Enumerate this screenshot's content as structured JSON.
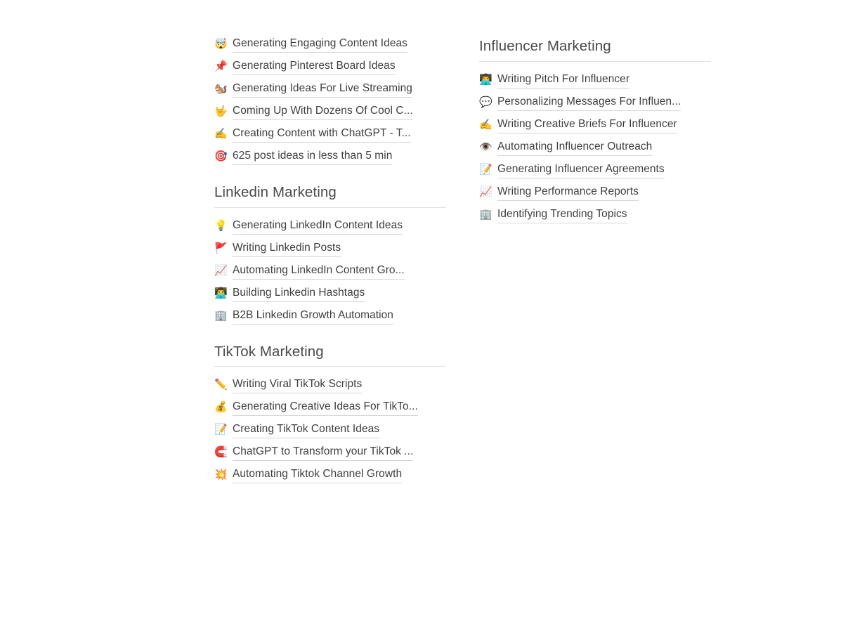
{
  "page": {
    "background_color": "#ffffff",
    "text_color": "#3f3f3f",
    "header_color": "#4a4a4a",
    "rule_color": "#e0e0e0",
    "underline_color": "#d6d6d6"
  },
  "columns": [
    {
      "name": "left-column",
      "sections": [
        {
          "id": "content-ideas",
          "heading": null,
          "items": [
            {
              "icon": "exploding-head-emoji",
              "glyph": "🤯",
              "label": "Generating Engaging Content Ideas",
              "truncated": false
            },
            {
              "icon": "pushpin-emoji",
              "glyph": "📌",
              "label": "Generating Pinterest Board Ideas",
              "truncated": false
            },
            {
              "icon": "chipmunk-emoji",
              "glyph": "🐿️",
              "label": "Generating Ideas For Live Streaming",
              "truncated": false
            },
            {
              "icon": "love-you-gesture-emoji",
              "glyph": "🤟",
              "label": "Coming Up With Dozens Of Cool C...",
              "truncated": true
            },
            {
              "icon": "writing-hand-emoji",
              "glyph": "✍️",
              "label": "Creating Content with ChatGPT - T...",
              "truncated": true
            },
            {
              "icon": "direct-hit-emoji",
              "glyph": "🎯",
              "label": "625 post ideas in less than 5 min",
              "truncated": false
            }
          ]
        },
        {
          "id": "linkedin-marketing",
          "heading": "Linkedin Marketing",
          "items": [
            {
              "icon": "light-bulb-emoji",
              "glyph": "💡",
              "label": "Generating LinkedIn Content Ideas",
              "truncated": false
            },
            {
              "icon": "triangular-flag-emoji",
              "glyph": "🚩",
              "label": "Writing Linkedin Posts",
              "truncated": false
            },
            {
              "icon": "chart-increasing-emoji",
              "glyph": "📈",
              "label": "Automating LinkedIn Content Gro...",
              "truncated": true
            },
            {
              "icon": "technologist-emoji",
              "glyph": "👨‍💻",
              "label": "Building Linkedin Hashtags",
              "truncated": false
            },
            {
              "icon": "office-building-emoji",
              "glyph": "🏢",
              "label": "B2B Linkedin Growth Automation",
              "truncated": false
            }
          ]
        },
        {
          "id": "tiktok-marketing",
          "heading": "TikTok Marketing",
          "items": [
            {
              "icon": "pencil-emoji",
              "glyph": "✏️",
              "label": "Writing Viral TikTok Scripts",
              "truncated": false
            },
            {
              "icon": "money-bag-emoji",
              "glyph": "💰",
              "label": "Generating Creative Ideas For TikTo...",
              "truncated": true
            },
            {
              "icon": "memo-emoji",
              "glyph": "📝",
              "label": "Creating TikTok Content Ideas",
              "truncated": false
            },
            {
              "icon": "magnet-emoji",
              "glyph": "🧲",
              "label": "ChatGPT to Transform your TikTok ...",
              "truncated": true
            },
            {
              "icon": "collision-emoji",
              "glyph": "💥",
              "label": "Automating Tiktok Channel Growth",
              "truncated": false
            }
          ]
        }
      ]
    },
    {
      "name": "right-column",
      "sections": [
        {
          "id": "influencer-marketing",
          "heading": "Influencer Marketing",
          "items": [
            {
              "icon": "technologist-emoji",
              "glyph": "👨‍💻",
              "label": "Writing Pitch For Influencer",
              "truncated": false
            },
            {
              "icon": "speech-balloon-emoji",
              "glyph": "💬",
              "label": "Personalizing Messages For Influen...",
              "truncated": true
            },
            {
              "icon": "writing-hand-emoji",
              "glyph": "✍️",
              "label": "Writing Creative Briefs For Influencer",
              "truncated": false
            },
            {
              "icon": "eye-emoji",
              "glyph": "👁️",
              "label": "Automating Influencer Outreach",
              "truncated": false
            },
            {
              "icon": "memo-emoji",
              "glyph": "📝",
              "label": "Generating Influencer Agreements",
              "truncated": false
            },
            {
              "icon": "chart-increasing-emoji",
              "glyph": "📈",
              "label": "Writing Performance Reports",
              "truncated": false
            },
            {
              "icon": "office-building-emoji",
              "glyph": "🏢",
              "label": "Identifying Trending Topics",
              "truncated": false
            }
          ]
        }
      ]
    }
  ]
}
